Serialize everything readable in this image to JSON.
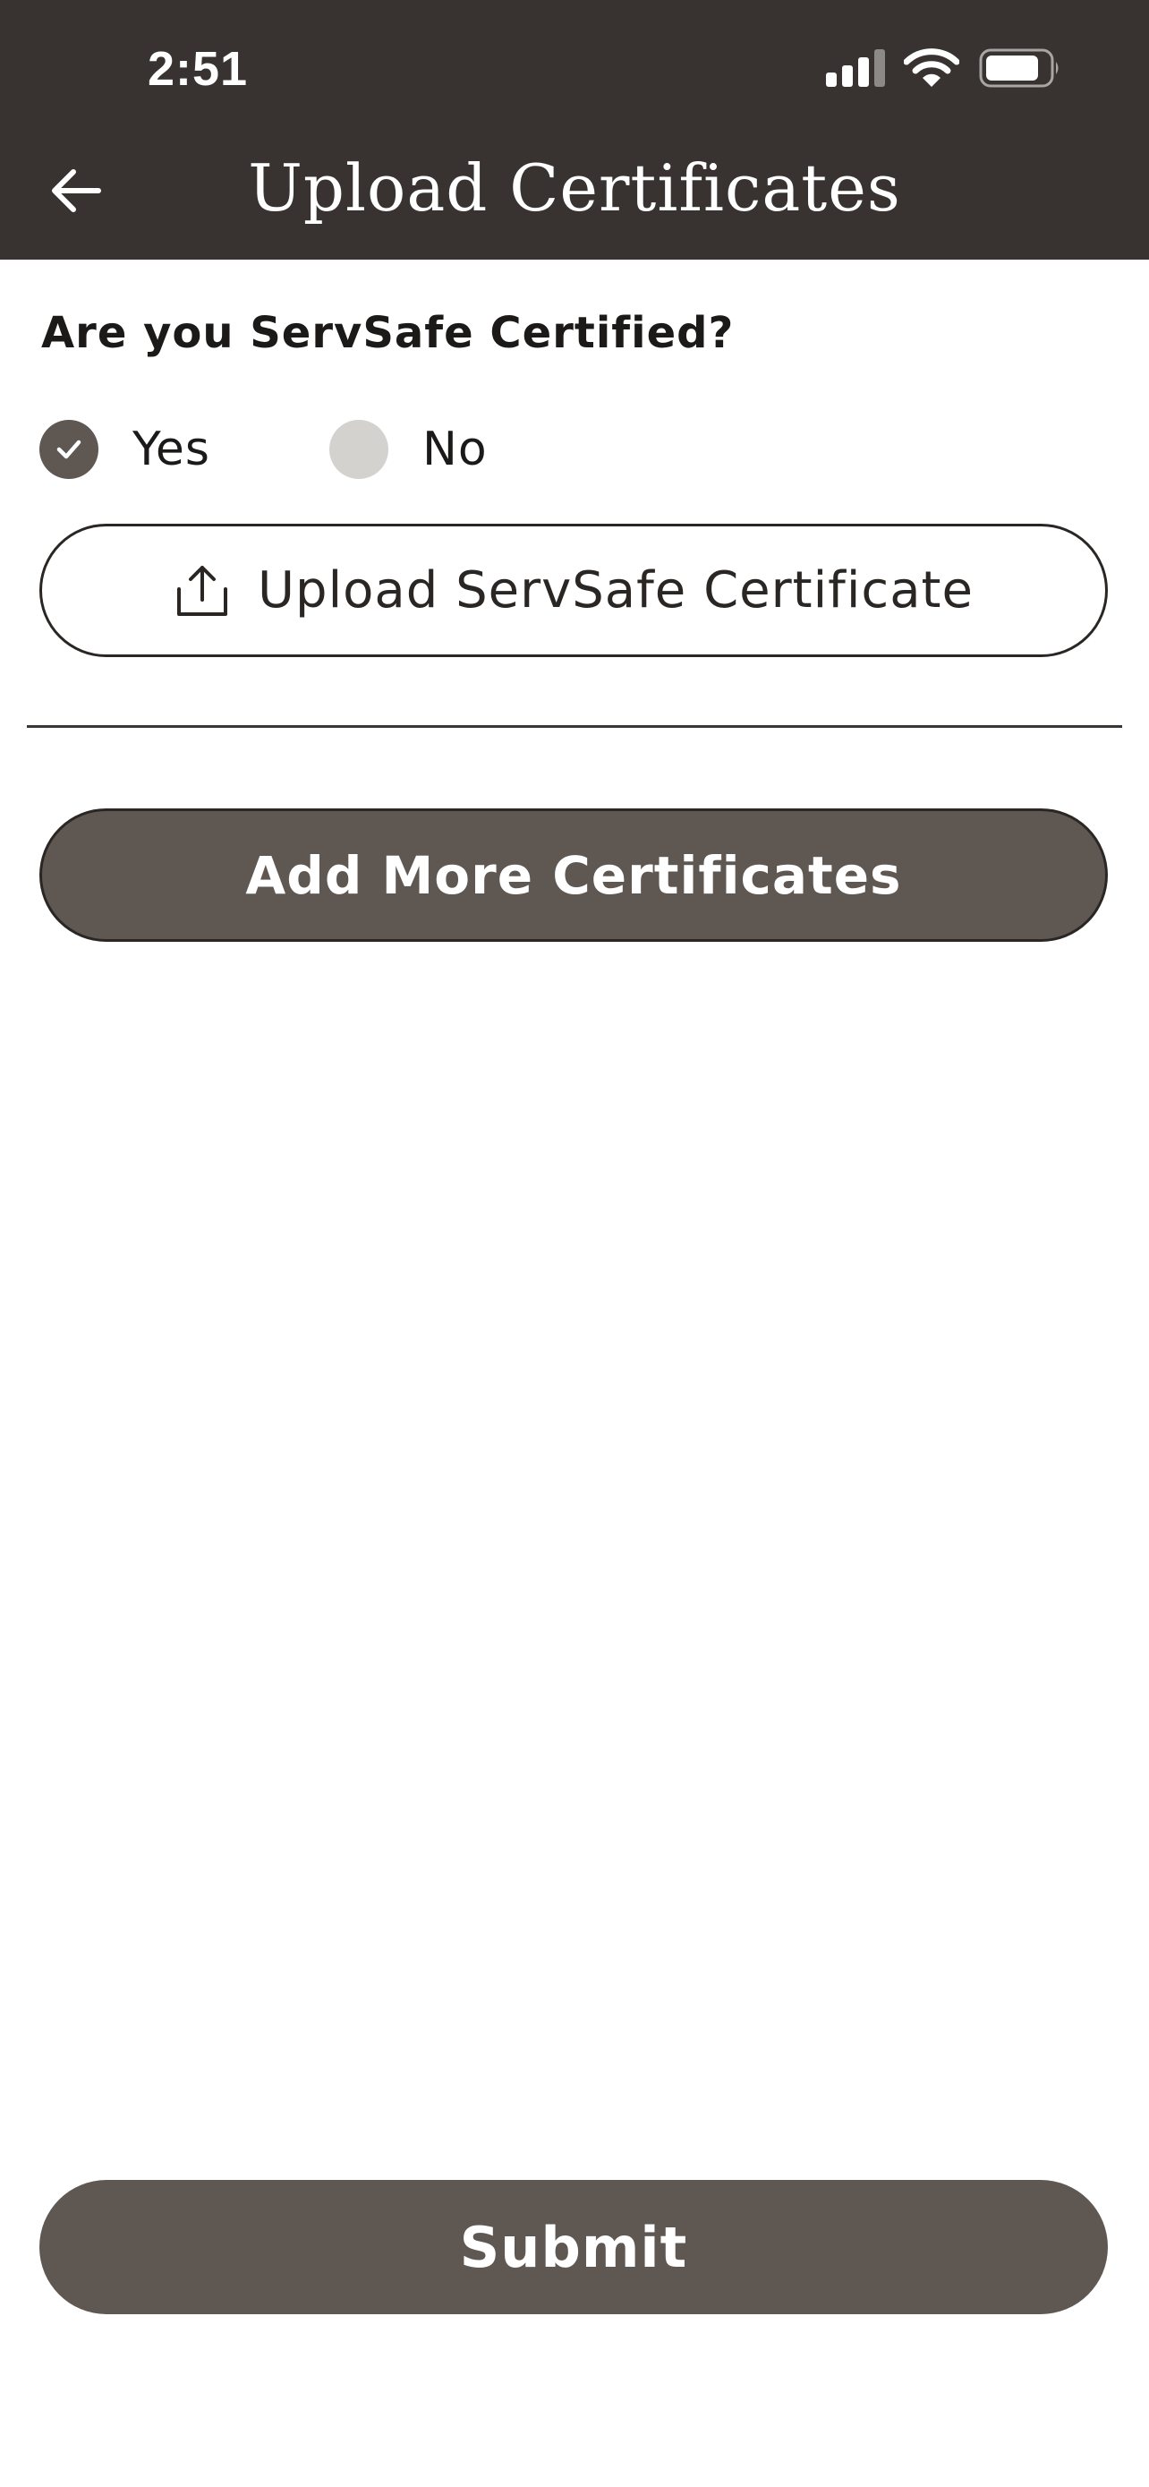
{
  "status_bar": {
    "time": "2:51",
    "icons": [
      "cellular-signal-icon",
      "wifi-icon",
      "battery-icon"
    ]
  },
  "header": {
    "title": "Upload Certificates",
    "back_icon": "arrow-left-icon"
  },
  "form": {
    "question": "Are you ServSafe Certified?",
    "options": [
      {
        "label": "Yes",
        "selected": true
      },
      {
        "label": "No",
        "selected": false
      }
    ],
    "upload_button": {
      "label": "Upload ServSafe Certificate",
      "icon": "upload-icon"
    },
    "add_more_button": {
      "label": "Add More Certificates"
    }
  },
  "footer": {
    "submit_label": "Submit"
  },
  "colors": {
    "header_bg": "#383331",
    "primary": "#5f5752",
    "radio_unchecked": "#d4d2cf",
    "text": "#1c1a19"
  }
}
